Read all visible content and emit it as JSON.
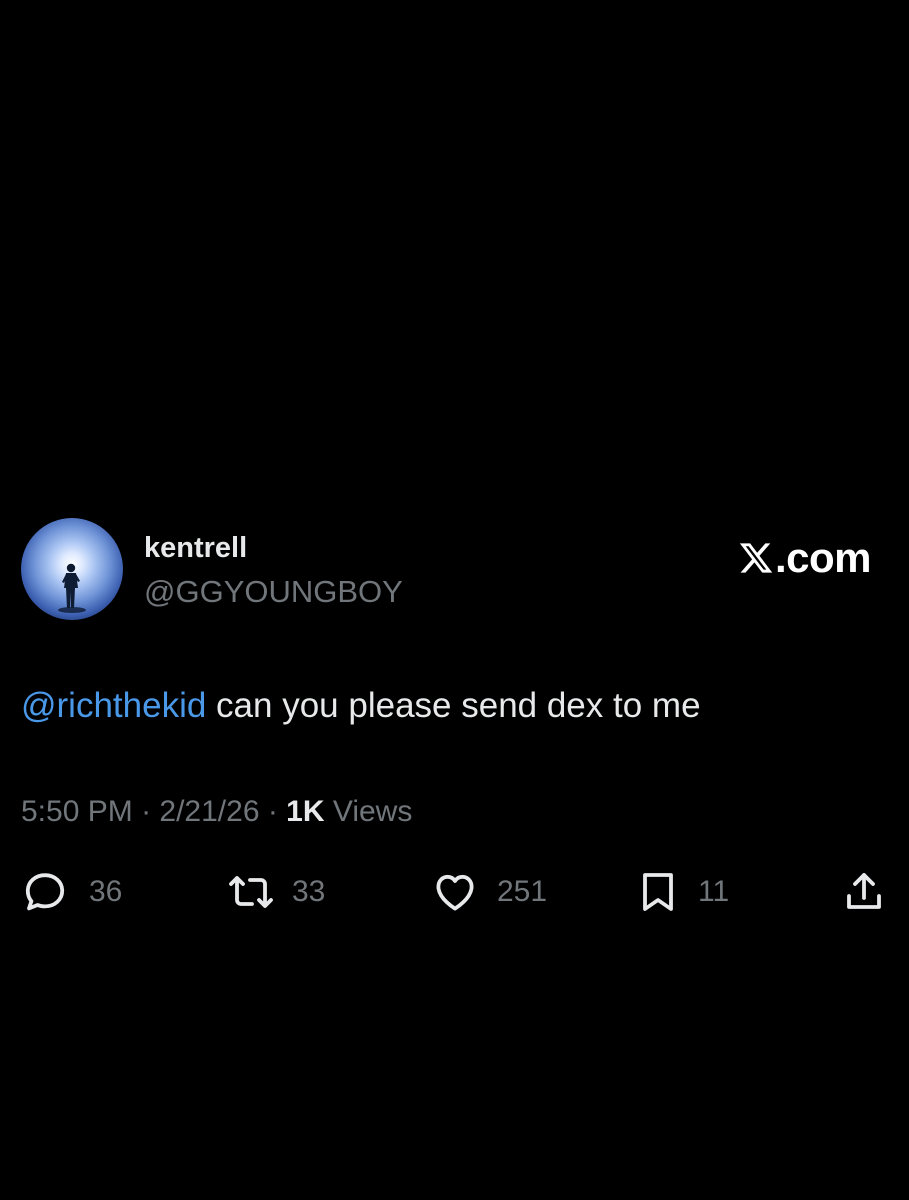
{
  "author": {
    "display_name": "kentrell",
    "handle": "@GGYOUNGBOY"
  },
  "brand": {
    "mark": "X",
    "suffix": ".com"
  },
  "tweet": {
    "mention": "@richthekid",
    "text": " can you please send dex to me"
  },
  "meta": {
    "time": "5:50 PM",
    "sep1": " · ",
    "date": "2/21/26",
    "sep2": " · ",
    "views_count": "1K",
    "views_label": " Views"
  },
  "actions": {
    "replies": "36",
    "reposts": "33",
    "likes": "251",
    "bookmarks": "11"
  },
  "icons": [
    "reply-icon",
    "repost-icon",
    "like-icon",
    "bookmark-icon",
    "share-icon",
    "x-logo-icon"
  ],
  "colors": {
    "background": "#000000",
    "primary_text": "#e7e9ea",
    "secondary_text": "#71767b",
    "mention": "#4a99e9"
  }
}
